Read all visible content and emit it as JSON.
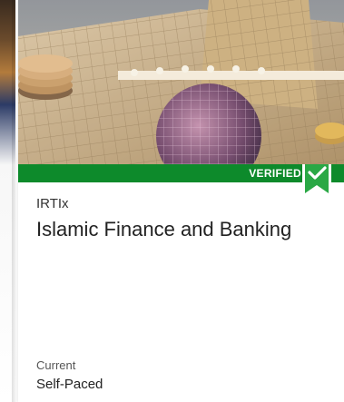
{
  "course": {
    "image_alt": "Course banner image",
    "verified_label": "VERIFIED",
    "organization": "IRTIx",
    "title": "Islamic Finance and Banking",
    "schedule_label": "Current",
    "pacing": "Self-Paced"
  },
  "colors": {
    "verified_green": "#0d8a2b",
    "badge_green": "#2aa845"
  },
  "icons": {
    "badge": "checkmark-ribbon-icon"
  }
}
